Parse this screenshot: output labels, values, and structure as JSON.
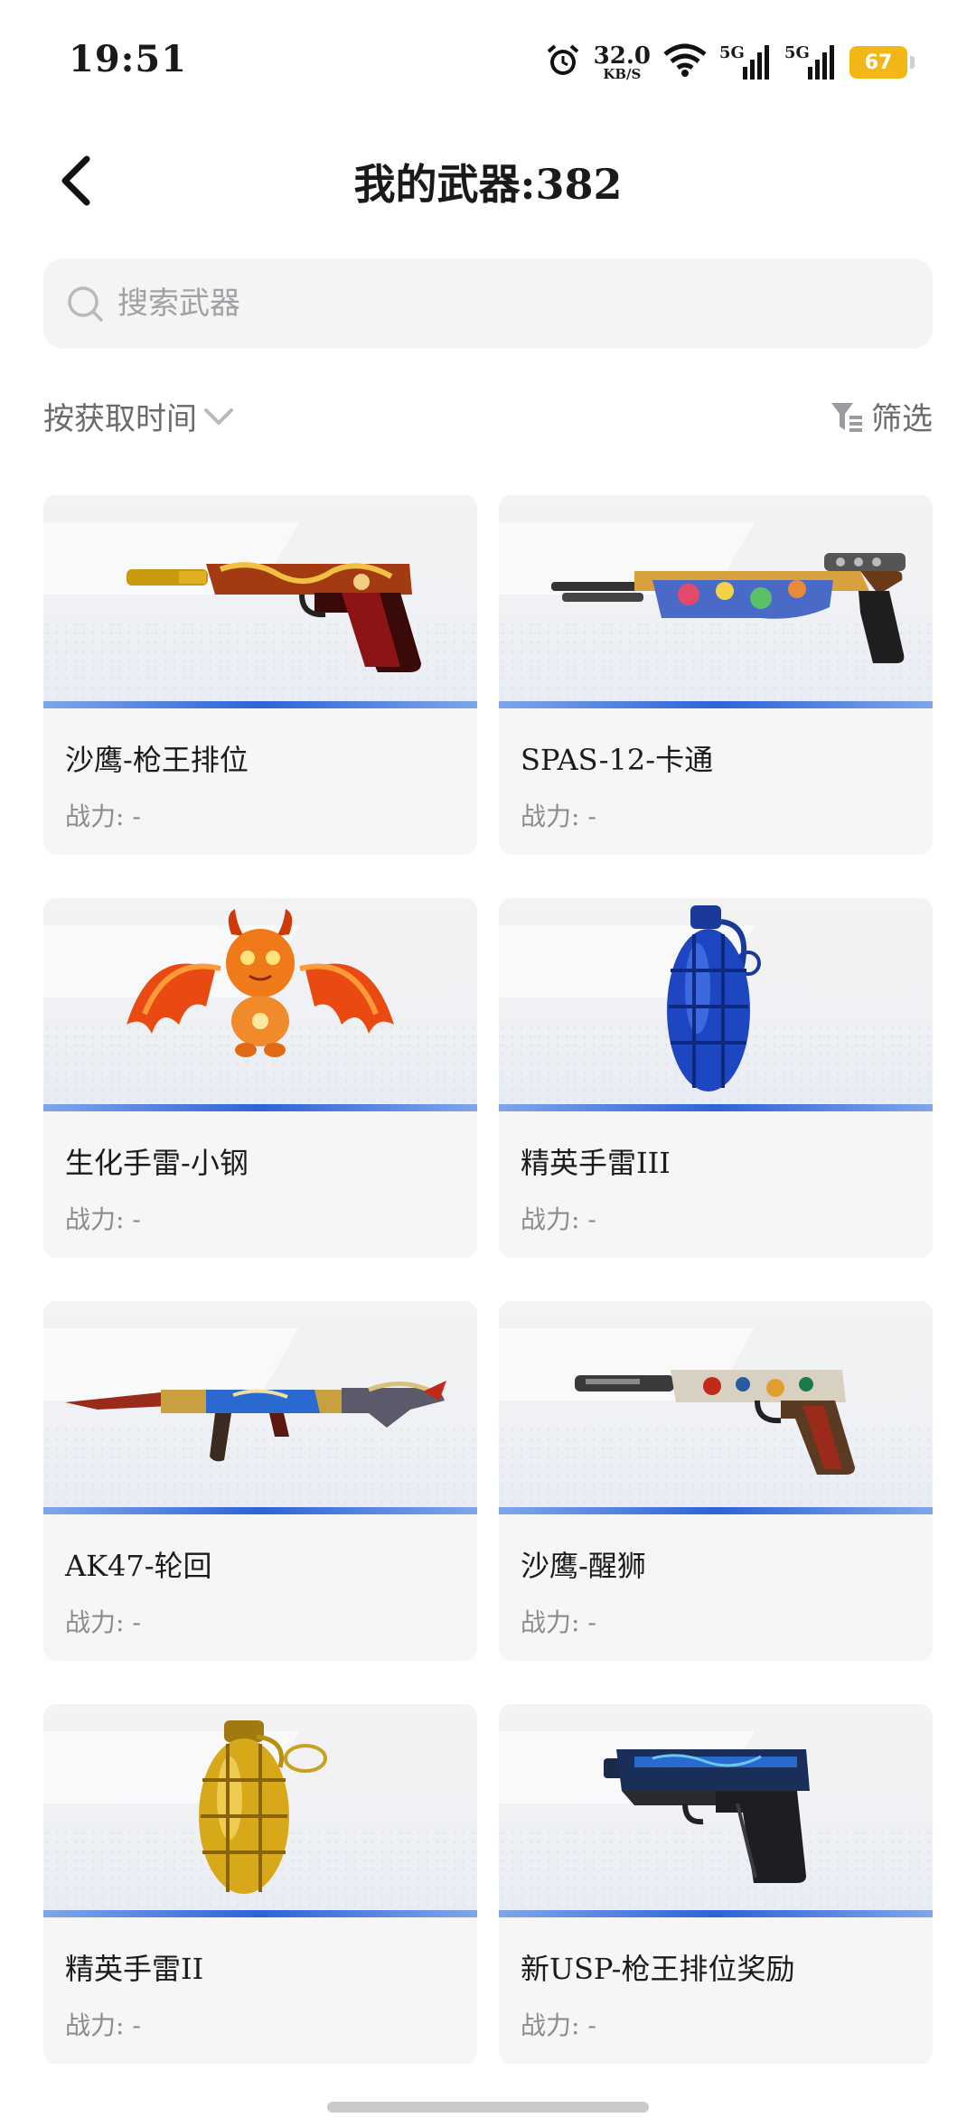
{
  "status_bar": {
    "time": "19:51",
    "net_speed": "32.0",
    "net_speed_unit": "KB/S",
    "signal1_label": "5G",
    "signal2_label": "5G",
    "battery": "67"
  },
  "header": {
    "title": "我的武器:382"
  },
  "search": {
    "placeholder": "搜索武器"
  },
  "toolbar": {
    "sort_label": "按获取时间",
    "filter_label": "筛选"
  },
  "weapons": [
    {
      "name": "沙鹰-枪王排位",
      "power": "战力: -",
      "icon": "desert-eagle-gold-red"
    },
    {
      "name": "SPAS-12-卡通",
      "power": "战力: -",
      "icon": "shotgun-cartoon"
    },
    {
      "name": "生化手雷-小钢",
      "power": "战力: -",
      "icon": "flame-bat-creature"
    },
    {
      "name": "精英手雷III",
      "power": "战力: -",
      "icon": "grenade-blue"
    },
    {
      "name": "AK47-轮回",
      "power": "战力: -",
      "icon": "rifle-ornate"
    },
    {
      "name": "沙鹰-醒狮",
      "power": "战力: -",
      "icon": "desert-eagle-lion"
    },
    {
      "name": "精英手雷II",
      "power": "战力: -",
      "icon": "grenade-gold"
    },
    {
      "name": "新USP-枪王排位奖励",
      "power": "战力: -",
      "icon": "usp-pistol-blue"
    }
  ],
  "colors": {
    "accent_blue": "#2d63d8",
    "battery": "#f2b616"
  }
}
